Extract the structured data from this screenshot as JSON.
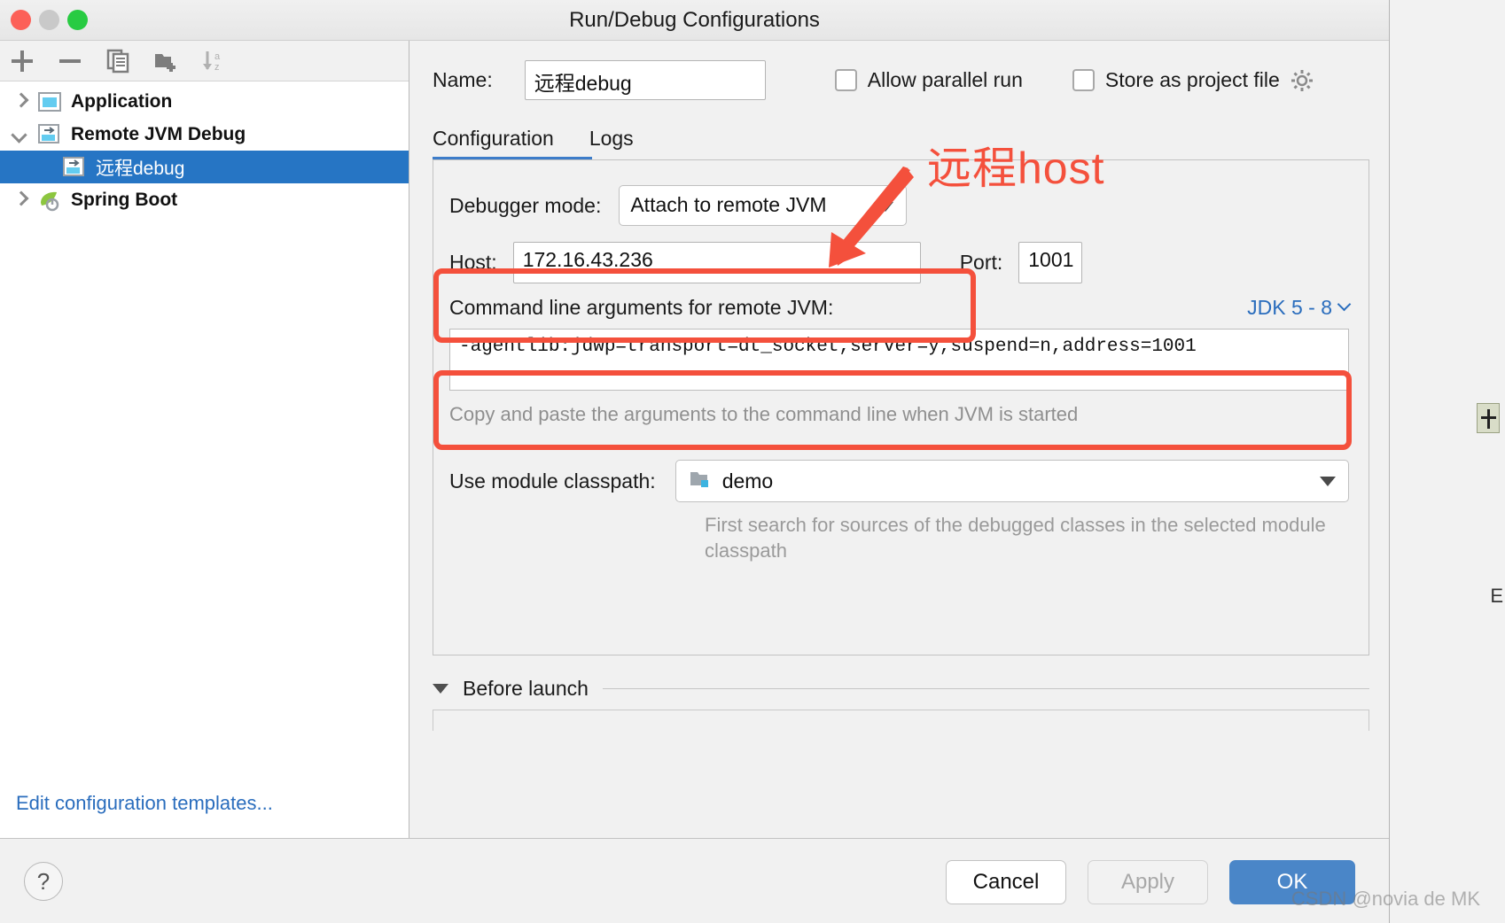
{
  "window": {
    "title": "Run/Debug Configurations",
    "traffic_lights": [
      "close",
      "minimize",
      "zoom"
    ]
  },
  "left_panel": {
    "toolbar": [
      {
        "name": "add-icon",
        "label": "+"
      },
      {
        "name": "remove-icon",
        "label": "−"
      },
      {
        "name": "copy-icon",
        "label": "Copy Configuration"
      },
      {
        "name": "new-folder-icon",
        "label": "Create New Folder"
      },
      {
        "name": "sort-alphabetically-icon",
        "label": "Sort Configurations"
      }
    ],
    "tree": [
      {
        "label": "Application",
        "level": 0,
        "expanded": false,
        "selected": false,
        "icon": "application-icon"
      },
      {
        "label": "Remote JVM Debug",
        "level": 0,
        "expanded": true,
        "selected": false,
        "icon": "remote-jvm-icon"
      },
      {
        "label": "远程debug",
        "level": 1,
        "expanded": null,
        "selected": true,
        "icon": "remote-jvm-icon"
      },
      {
        "label": "Spring Boot",
        "level": 0,
        "expanded": false,
        "selected": false,
        "icon": "spring-boot-icon"
      }
    ],
    "edit_templates_link": "Edit configuration templates..."
  },
  "form": {
    "name_label": "Name:",
    "name_value": "远程debug",
    "allow_parallel_run_label": "Allow parallel run",
    "allow_parallel_run_checked": false,
    "store_as_project_file_label": "Store as project file",
    "store_as_project_file_checked": false,
    "tabs": [
      {
        "label": "Configuration",
        "active": true
      },
      {
        "label": "Logs",
        "active": false
      }
    ],
    "debugger_mode_label": "Debugger mode:",
    "debugger_mode_value": "Attach to remote JVM",
    "host_label": "Host:",
    "host_value": "172.16.43.236",
    "port_label": "Port:",
    "port_value": "1001",
    "cmd_label": "Command line arguments for remote JVM:",
    "jdk_link": "JDK 5 - 8",
    "cmd_value": "-agentlib:jdwp=transport=dt_socket,server=y,suspend=n,address=1001",
    "cmd_hint": "Copy and paste the arguments to the command line when JVM is started",
    "module_label": "Use module classpath:",
    "module_value": "demo",
    "module_hint": "First search for sources of the debugged classes in the selected module classpath",
    "before_launch_label": "Before launch"
  },
  "bottom": {
    "help_label": "?",
    "cancel_label": "Cancel",
    "apply_label": "Apply",
    "ok_label": "OK"
  },
  "annotations": {
    "callout_text": "远程host",
    "color": "#f4503c"
  },
  "watermark": "CSDN @novia de MK"
}
